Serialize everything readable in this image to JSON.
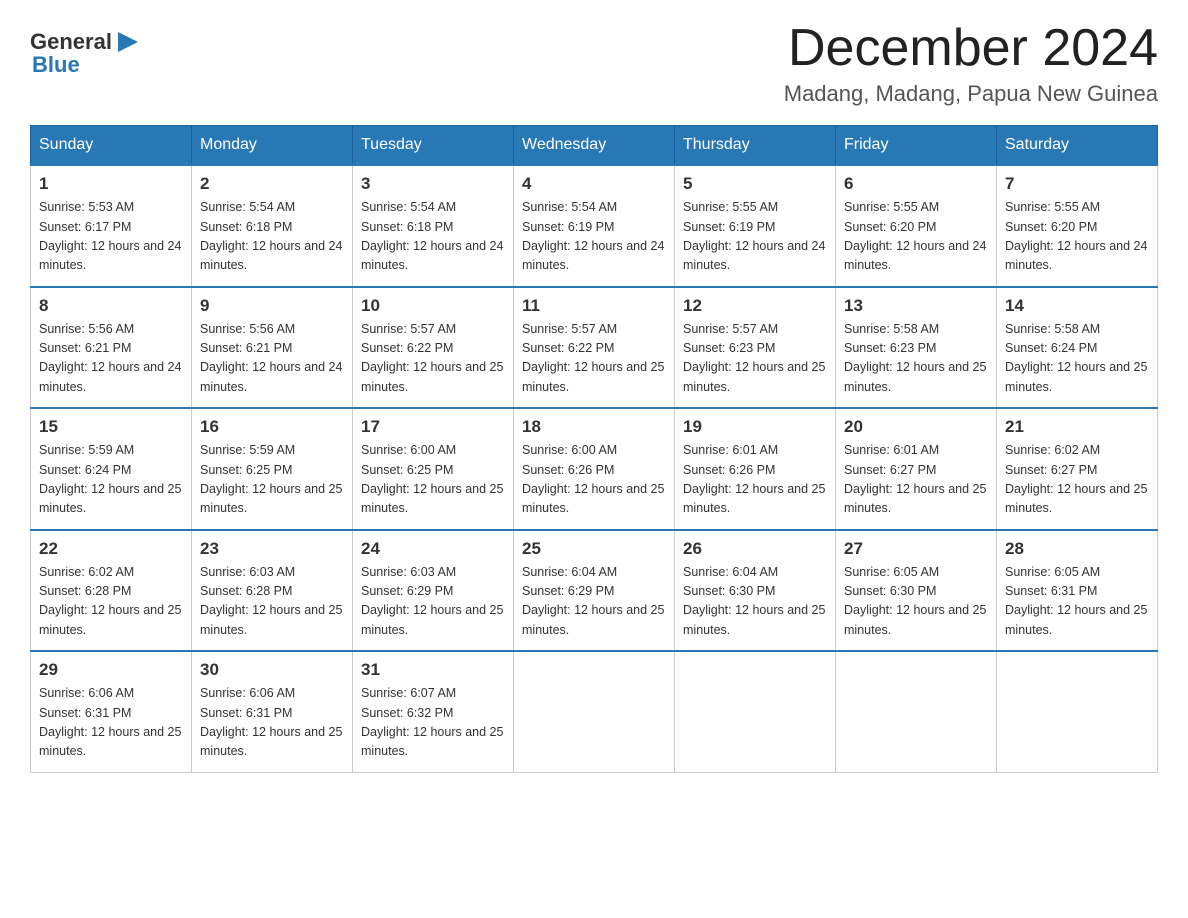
{
  "header": {
    "logo_general": "General",
    "logo_blue": "Blue",
    "title": "December 2024",
    "subtitle": "Madang, Madang, Papua New Guinea"
  },
  "days_of_week": [
    "Sunday",
    "Monday",
    "Tuesday",
    "Wednesday",
    "Thursday",
    "Friday",
    "Saturday"
  ],
  "weeks": [
    [
      {
        "day": "1",
        "sunrise": "5:53 AM",
        "sunset": "6:17 PM",
        "daylight": "12 hours and 24 minutes."
      },
      {
        "day": "2",
        "sunrise": "5:54 AM",
        "sunset": "6:18 PM",
        "daylight": "12 hours and 24 minutes."
      },
      {
        "day": "3",
        "sunrise": "5:54 AM",
        "sunset": "6:18 PM",
        "daylight": "12 hours and 24 minutes."
      },
      {
        "day": "4",
        "sunrise": "5:54 AM",
        "sunset": "6:19 PM",
        "daylight": "12 hours and 24 minutes."
      },
      {
        "day": "5",
        "sunrise": "5:55 AM",
        "sunset": "6:19 PM",
        "daylight": "12 hours and 24 minutes."
      },
      {
        "day": "6",
        "sunrise": "5:55 AM",
        "sunset": "6:20 PM",
        "daylight": "12 hours and 24 minutes."
      },
      {
        "day": "7",
        "sunrise": "5:55 AM",
        "sunset": "6:20 PM",
        "daylight": "12 hours and 24 minutes."
      }
    ],
    [
      {
        "day": "8",
        "sunrise": "5:56 AM",
        "sunset": "6:21 PM",
        "daylight": "12 hours and 24 minutes."
      },
      {
        "day": "9",
        "sunrise": "5:56 AM",
        "sunset": "6:21 PM",
        "daylight": "12 hours and 24 minutes."
      },
      {
        "day": "10",
        "sunrise": "5:57 AM",
        "sunset": "6:22 PM",
        "daylight": "12 hours and 25 minutes."
      },
      {
        "day": "11",
        "sunrise": "5:57 AM",
        "sunset": "6:22 PM",
        "daylight": "12 hours and 25 minutes."
      },
      {
        "day": "12",
        "sunrise": "5:57 AM",
        "sunset": "6:23 PM",
        "daylight": "12 hours and 25 minutes."
      },
      {
        "day": "13",
        "sunrise": "5:58 AM",
        "sunset": "6:23 PM",
        "daylight": "12 hours and 25 minutes."
      },
      {
        "day": "14",
        "sunrise": "5:58 AM",
        "sunset": "6:24 PM",
        "daylight": "12 hours and 25 minutes."
      }
    ],
    [
      {
        "day": "15",
        "sunrise": "5:59 AM",
        "sunset": "6:24 PM",
        "daylight": "12 hours and 25 minutes."
      },
      {
        "day": "16",
        "sunrise": "5:59 AM",
        "sunset": "6:25 PM",
        "daylight": "12 hours and 25 minutes."
      },
      {
        "day": "17",
        "sunrise": "6:00 AM",
        "sunset": "6:25 PM",
        "daylight": "12 hours and 25 minutes."
      },
      {
        "day": "18",
        "sunrise": "6:00 AM",
        "sunset": "6:26 PM",
        "daylight": "12 hours and 25 minutes."
      },
      {
        "day": "19",
        "sunrise": "6:01 AM",
        "sunset": "6:26 PM",
        "daylight": "12 hours and 25 minutes."
      },
      {
        "day": "20",
        "sunrise": "6:01 AM",
        "sunset": "6:27 PM",
        "daylight": "12 hours and 25 minutes."
      },
      {
        "day": "21",
        "sunrise": "6:02 AM",
        "sunset": "6:27 PM",
        "daylight": "12 hours and 25 minutes."
      }
    ],
    [
      {
        "day": "22",
        "sunrise": "6:02 AM",
        "sunset": "6:28 PM",
        "daylight": "12 hours and 25 minutes."
      },
      {
        "day": "23",
        "sunrise": "6:03 AM",
        "sunset": "6:28 PM",
        "daylight": "12 hours and 25 minutes."
      },
      {
        "day": "24",
        "sunrise": "6:03 AM",
        "sunset": "6:29 PM",
        "daylight": "12 hours and 25 minutes."
      },
      {
        "day": "25",
        "sunrise": "6:04 AM",
        "sunset": "6:29 PM",
        "daylight": "12 hours and 25 minutes."
      },
      {
        "day": "26",
        "sunrise": "6:04 AM",
        "sunset": "6:30 PM",
        "daylight": "12 hours and 25 minutes."
      },
      {
        "day": "27",
        "sunrise": "6:05 AM",
        "sunset": "6:30 PM",
        "daylight": "12 hours and 25 minutes."
      },
      {
        "day": "28",
        "sunrise": "6:05 AM",
        "sunset": "6:31 PM",
        "daylight": "12 hours and 25 minutes."
      }
    ],
    [
      {
        "day": "29",
        "sunrise": "6:06 AM",
        "sunset": "6:31 PM",
        "daylight": "12 hours and 25 minutes."
      },
      {
        "day": "30",
        "sunrise": "6:06 AM",
        "sunset": "6:31 PM",
        "daylight": "12 hours and 25 minutes."
      },
      {
        "day": "31",
        "sunrise": "6:07 AM",
        "sunset": "6:32 PM",
        "daylight": "12 hours and 25 minutes."
      },
      null,
      null,
      null,
      null
    ]
  ]
}
